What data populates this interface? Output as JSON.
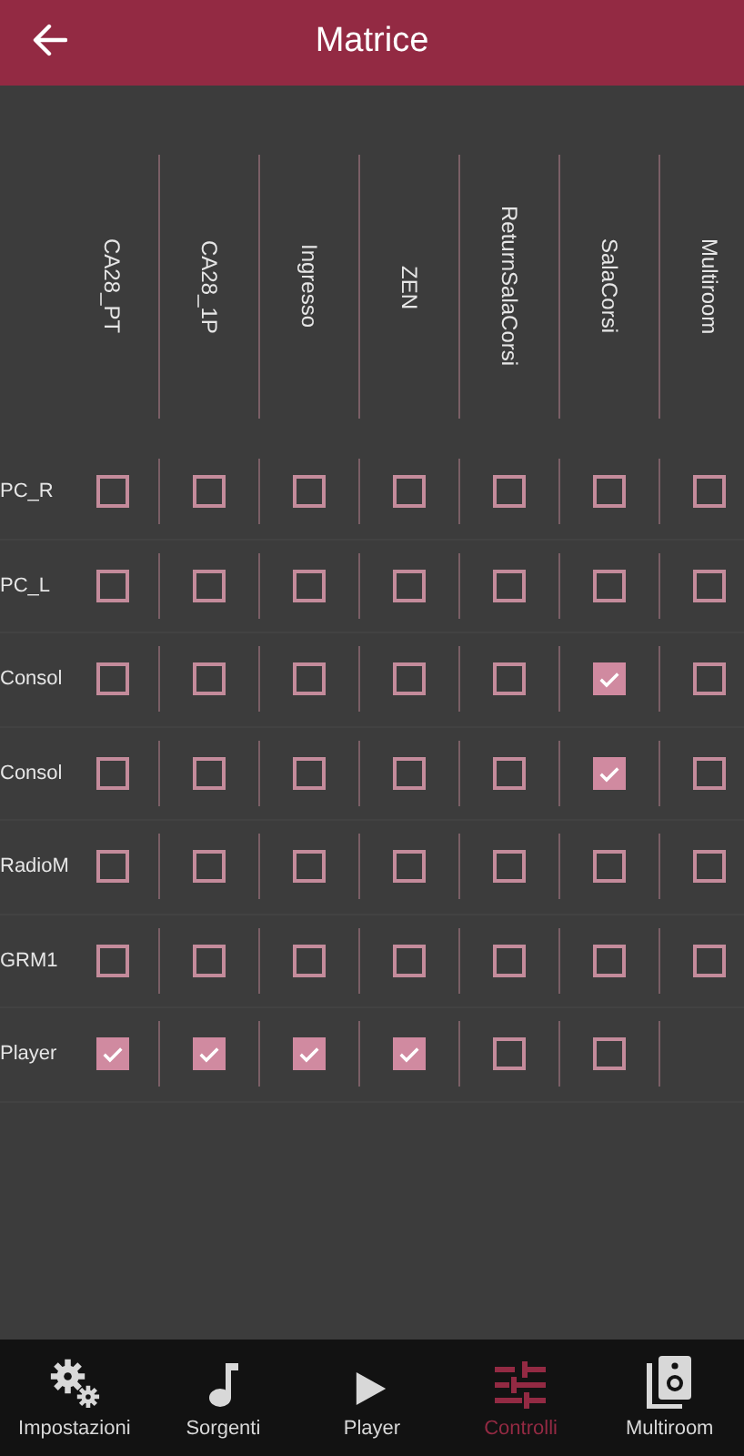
{
  "header": {
    "title": "Matrice"
  },
  "matrix": {
    "columns": [
      "CA28_PT",
      "CA28_1P",
      "Ingresso",
      "ZEN",
      "ReturnSalaCorsi",
      "SalaCorsi",
      "Multiroom"
    ],
    "rows": [
      {
        "label": "PC_R",
        "cells": [
          {
            "checked": false
          },
          {
            "checked": false
          },
          {
            "checked": false
          },
          {
            "checked": false
          },
          {
            "checked": false
          },
          {
            "checked": false
          },
          {
            "checked": false
          }
        ]
      },
      {
        "label": "PC_L",
        "cells": [
          {
            "checked": false
          },
          {
            "checked": false
          },
          {
            "checked": false
          },
          {
            "checked": false
          },
          {
            "checked": false
          },
          {
            "checked": false
          },
          {
            "checked": false
          }
        ]
      },
      {
        "label": "Consol",
        "cells": [
          {
            "checked": false
          },
          {
            "checked": false
          },
          {
            "checked": false
          },
          {
            "checked": false
          },
          {
            "checked": false
          },
          {
            "checked": true
          },
          {
            "checked": false
          }
        ]
      },
      {
        "label": "Consol",
        "cells": [
          {
            "checked": false
          },
          {
            "checked": false
          },
          {
            "checked": false
          },
          {
            "checked": false
          },
          {
            "checked": false
          },
          {
            "checked": true
          },
          {
            "checked": false
          }
        ]
      },
      {
        "label": "RadioM",
        "cells": [
          {
            "checked": false
          },
          {
            "checked": false
          },
          {
            "checked": false
          },
          {
            "checked": false
          },
          {
            "checked": false
          },
          {
            "checked": false
          },
          {
            "checked": false
          }
        ]
      },
      {
        "label": "GRM1",
        "cells": [
          {
            "checked": false
          },
          {
            "checked": false
          },
          {
            "checked": false
          },
          {
            "checked": false
          },
          {
            "checked": false
          },
          {
            "checked": false
          },
          {
            "checked": false
          }
        ]
      },
      {
        "label": "Player",
        "cells": [
          {
            "checked": true
          },
          {
            "checked": true
          },
          {
            "checked": true
          },
          {
            "checked": true
          },
          {
            "checked": false
          },
          {
            "checked": false
          }
        ]
      }
    ]
  },
  "tab_bar": [
    {
      "kind": "gears",
      "label": "Impostazioni",
      "selected": false
    },
    {
      "kind": "note",
      "label": "Sorgenti",
      "selected": false
    },
    {
      "kind": "play",
      "label": "Player",
      "selected": false
    },
    {
      "kind": "sliders",
      "label": "Controlli",
      "selected": true
    },
    {
      "kind": "speaker",
      "label": "Multiroom",
      "selected": false
    }
  ]
}
